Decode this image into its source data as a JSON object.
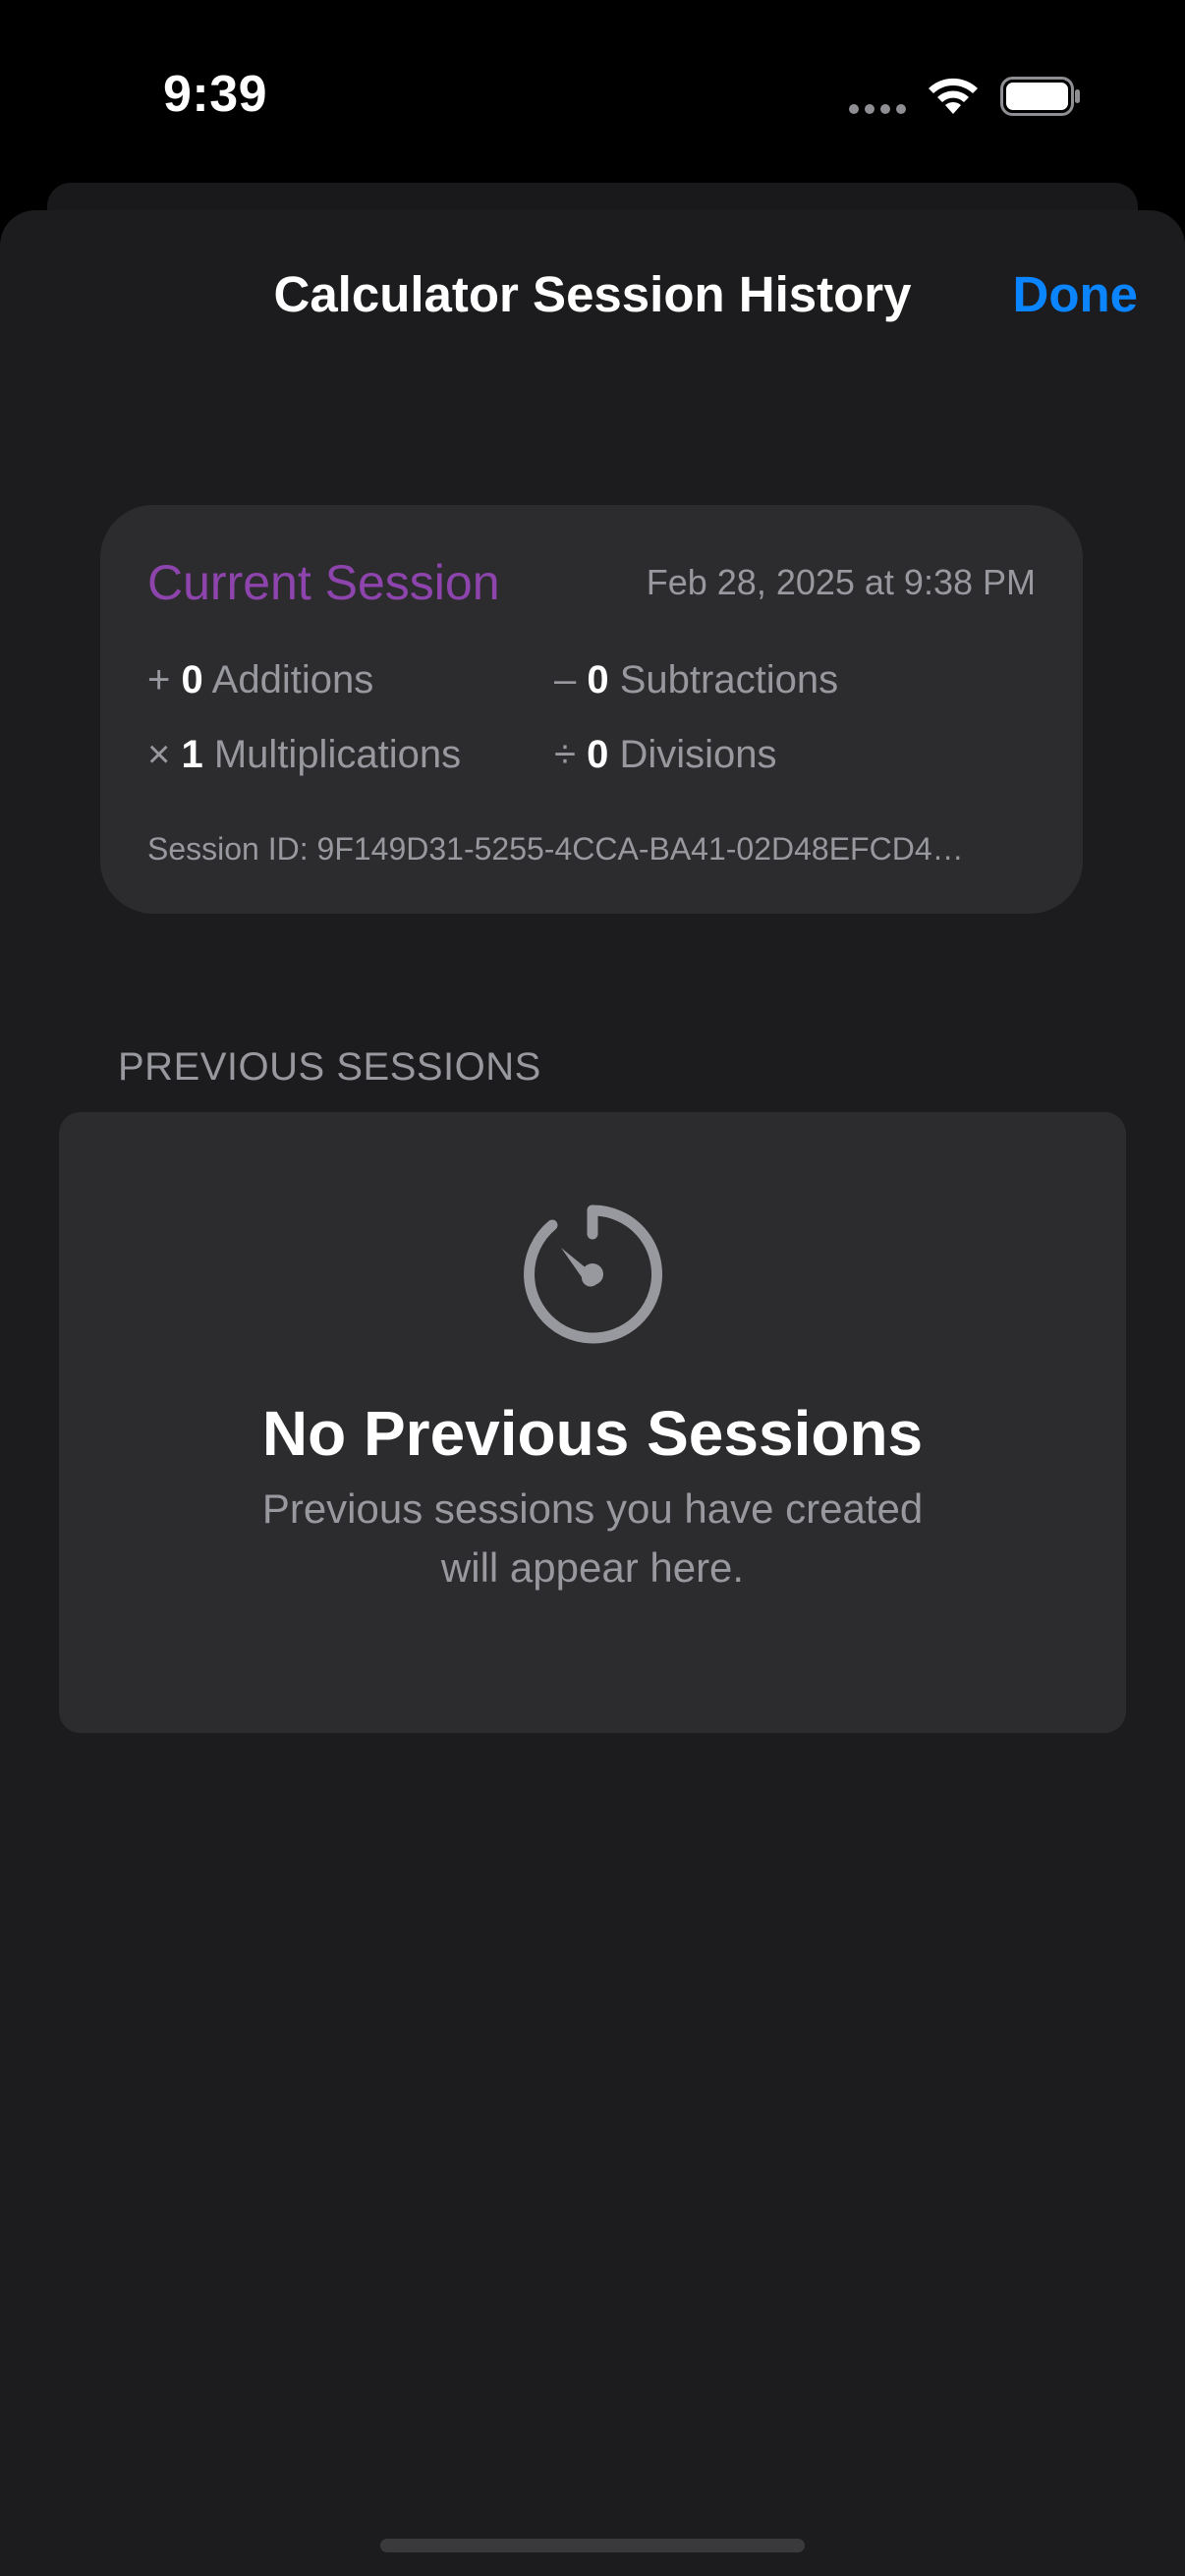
{
  "status_bar": {
    "time": "9:39"
  },
  "nav": {
    "title": "Calculator Session History",
    "done_label": "Done"
  },
  "current_session": {
    "title": "Current Session",
    "date": "Feb 28, 2025 at 9:38 PM",
    "additions": {
      "symbol": "+",
      "count": "0",
      "label": "Additions"
    },
    "subtractions": {
      "symbol": "–",
      "count": "0",
      "label": "Subtractions"
    },
    "multiplications": {
      "symbol": "×",
      "count": "1",
      "label": "Multiplications"
    },
    "divisions": {
      "symbol": "÷",
      "count": "0",
      "label": "Divisions"
    },
    "session_id": "Session ID: 9F149D31-5255-4CCA-BA41-02D48EFCD4…"
  },
  "previous_sessions": {
    "header": "PREVIOUS SESSIONS",
    "empty_icon": "timer-icon",
    "empty_title": "No Previous Sessions",
    "empty_subtitle": "Previous sessions you have created will appear here."
  },
  "colors": {
    "accent_blue": "#0a84ff",
    "session_purple": "#8e44ad",
    "card_bg": "#2c2c2e",
    "sheet_bg": "#1c1c1e",
    "secondary_text": "#98989f"
  }
}
